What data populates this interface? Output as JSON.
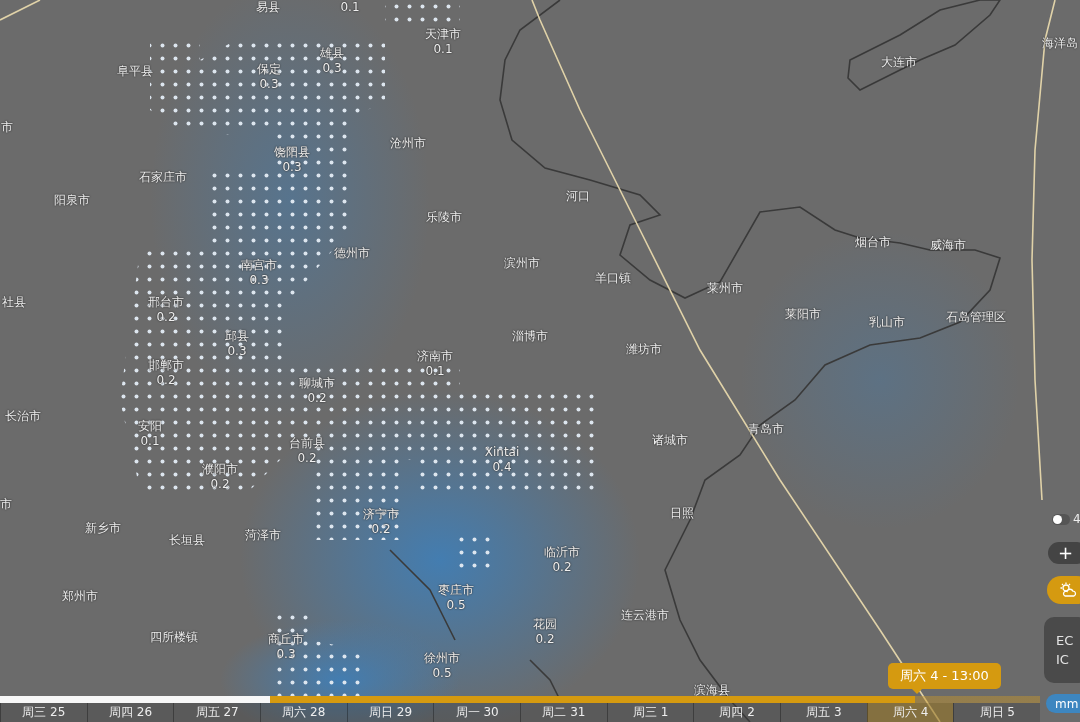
{
  "map_labels": [
    {
      "name": "易县"
    },
    {
      "value": "0.1"
    },
    {
      "name": "天津市",
      "value": "0.1"
    },
    {
      "name": "雄县",
      "value": "0.3"
    },
    {
      "name": "保定",
      "value": "0.3"
    },
    {
      "name": "阜平县"
    },
    {
      "name": "海洋岛"
    },
    {
      "name": "大连市"
    },
    {
      "name": "市"
    },
    {
      "name": "沧州市"
    },
    {
      "name": "饶阳县",
      "value": "0.3"
    },
    {
      "name": "石家庄市"
    },
    {
      "name": "阳泉市"
    },
    {
      "name": "河口"
    },
    {
      "name": "乐陵市"
    },
    {
      "name": "德州市"
    },
    {
      "name": "滨州市"
    },
    {
      "name": "南宫市",
      "value": "0.3"
    },
    {
      "name": "烟台市"
    },
    {
      "name": "威海市"
    },
    {
      "name": "羊口镇"
    },
    {
      "name": "莱州市"
    },
    {
      "name": "社县"
    },
    {
      "name": "邢台市",
      "value": "0.2"
    },
    {
      "name": "莱阳市"
    },
    {
      "name": "乳山市"
    },
    {
      "name": "石岛管理区"
    },
    {
      "name": "淄博市"
    },
    {
      "name": "邱县",
      "value": "0.3"
    },
    {
      "name": "潍坊市"
    },
    {
      "name": "济南市",
      "value": "0.1"
    },
    {
      "name": "邯郸市",
      "value": "0.2"
    },
    {
      "name": "聊城市",
      "value": "0.2"
    },
    {
      "name": "长治市"
    },
    {
      "name": "安阳",
      "value": "0.1"
    },
    {
      "name": "台前县",
      "value": "0.2"
    },
    {
      "name": "Xintai",
      "value": "0.4"
    },
    {
      "name": "诸城市"
    },
    {
      "name": "青岛市"
    },
    {
      "name": "濮阳市",
      "value": "0.2"
    },
    {
      "name": "市"
    },
    {
      "name": "济宁市",
      "value": "0.2"
    },
    {
      "name": "日照"
    },
    {
      "name": "新乡市"
    },
    {
      "name": "长垣县"
    },
    {
      "name": "菏泽市"
    },
    {
      "name": "临沂市",
      "value": "0.2"
    },
    {
      "name": "郑州市"
    },
    {
      "name": "枣庄市",
      "value": "0.5"
    },
    {
      "name": "连云港市"
    },
    {
      "name": "花园",
      "value": "0.2"
    },
    {
      "name": "四所楼镇"
    },
    {
      "name": "商丘市",
      "value": "0.3"
    },
    {
      "name": "徐州市",
      "value": "0.5"
    },
    {
      "name": "滨海县"
    }
  ],
  "controls": {
    "toggle": {
      "on": false,
      "label": "4"
    },
    "zoom_in": "+",
    "models": [
      "EC",
      "IC"
    ],
    "unit": "mm"
  },
  "timeline": {
    "tooltip": "周六 4 - 13:00",
    "level": 0.88,
    "days": [
      {
        "label": "周三 25",
        "selected": false
      },
      {
        "label": "周四 26",
        "selected": false
      },
      {
        "label": "周五 27",
        "selected": false
      },
      {
        "label": "周六 28",
        "selected": false
      },
      {
        "label": "周日 29",
        "selected": false
      },
      {
        "label": "周一 30",
        "selected": false
      },
      {
        "label": "周二 31",
        "selected": false
      },
      {
        "label": "周三 1",
        "selected": false
      },
      {
        "label": "周四 2",
        "selected": false
      },
      {
        "label": "周五 3",
        "selected": false
      },
      {
        "label": "周六 4",
        "selected": true
      },
      {
        "label": "周日 5",
        "selected": false
      }
    ]
  }
}
